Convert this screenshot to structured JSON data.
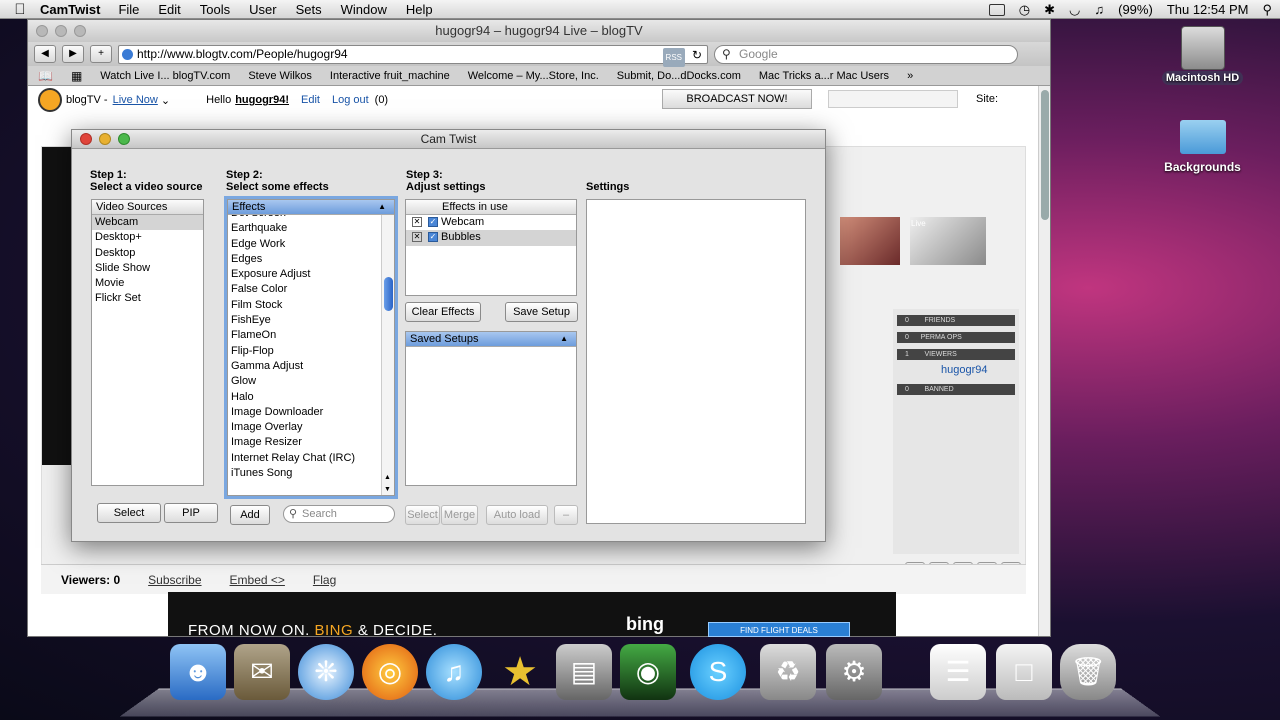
{
  "menubar": {
    "app": "CamTwist",
    "items": [
      "File",
      "Edit",
      "Tools",
      "User",
      "Sets",
      "Window",
      "Help"
    ],
    "battery": "(99%)",
    "clock": "Thu 12:54 PM"
  },
  "browser": {
    "title": "hugogr94 – hugogr94 Live – blogTV",
    "url": "http://www.blogtv.com/People/hugogr94",
    "rss": "RSS",
    "search_placeholder": "Google",
    "bookmarks": [
      "Watch Live I... blogTV.com",
      "Steve Wilkos",
      "Interactive fruit_machine",
      "Welcome – My...Store, Inc.",
      "Submit, Do...dDocks.com",
      "Mac Tricks a...r Mac Users"
    ]
  },
  "blogtv": {
    "brand": "blogTV",
    "live_now": "Live Now",
    "hello": "Hello",
    "username": "hugogr94!",
    "edit": "Edit",
    "logout": "Log out",
    "messages": "(0)",
    "broadcast": "BROADCAST NOW!",
    "site": "Site:",
    "panel": {
      "bars": [
        "FRIENDS",
        "PERMA OPS",
        "VIEWERS"
      ],
      "counts": [
        "0",
        "0",
        "1"
      ],
      "user": "hugogr94",
      "banned": "BANNED",
      "banned_count": "0"
    },
    "viewers": "Viewers: 0",
    "subscribe": "Subscribe",
    "embed": "Embed <>",
    "flag": "Flag",
    "thumb_badge": "Live",
    "ad": {
      "text_a": "FROM NOW ON.",
      "text_b": "BING",
      "text_c": "& DECIDE.",
      "logo": "bing",
      "deal": "FIND FLIGHT DEALS"
    }
  },
  "camtwist": {
    "title": "Cam Twist",
    "step1": {
      "title": "Step 1:",
      "subtitle": "Select a video source"
    },
    "step2": {
      "title": "Step 2:",
      "subtitle": "Select some effects"
    },
    "step3": {
      "title": "Step 3:",
      "subtitle": "Adjust settings"
    },
    "settings_label": "Settings",
    "sources_header": "Video Sources",
    "sources": [
      "Webcam",
      "Desktop+",
      "Desktop",
      "Slide Show",
      "Movie",
      "Flickr Set"
    ],
    "effects_header": "Effects",
    "effects": [
      "Dot Screen",
      "Earthquake",
      "Edge Work",
      "Edges",
      "Exposure Adjust",
      "False Color",
      "Film Stock",
      "FishEye",
      "FlameOn",
      "Flip-Flop",
      "Gamma Adjust",
      "Glow",
      "Halo",
      "Image Downloader",
      "Image Overlay",
      "Image Resizer",
      "Internet Relay Chat (IRC)",
      "iTunes Song"
    ],
    "in_use_header": "Effects in use",
    "in_use": [
      "Webcam",
      "Bubbles"
    ],
    "saved_header": "Saved Setups",
    "buttons": {
      "select": "Select",
      "pip": "PIP",
      "add": "Add",
      "search": "Search",
      "select2": "Select",
      "merge": "Merge",
      "autoload": "Auto load",
      "minus": "–",
      "clear": "Clear Effects",
      "save": "Save Setup"
    }
  },
  "desktop": {
    "hd": "Macintosh HD",
    "backgrounds": "Backgrounds"
  }
}
